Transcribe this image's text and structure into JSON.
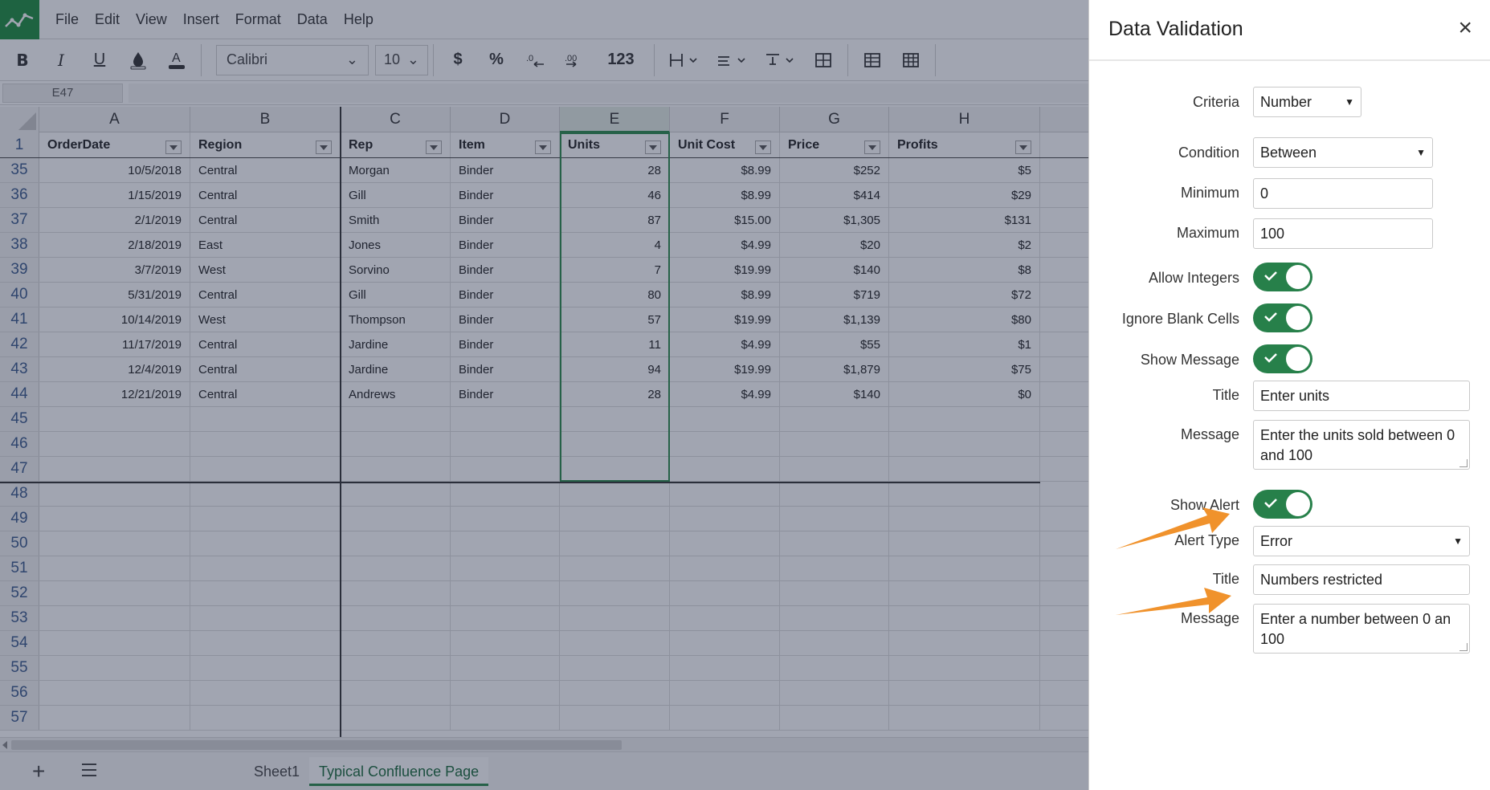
{
  "menu": [
    "File",
    "Edit",
    "View",
    "Insert",
    "Format",
    "Data",
    "Help"
  ],
  "toolbar": {
    "font": "Calibri",
    "size": "10",
    "currency": "$",
    "percent": "%",
    "number_format": "123"
  },
  "namebox": "E47",
  "columns": [
    "A",
    "B",
    "C",
    "D",
    "E",
    "F",
    "G",
    "H"
  ],
  "header_row": {
    "num": "1",
    "cells": [
      "OrderDate",
      "Region",
      "Rep",
      "Item",
      "Units",
      "Unit Cost",
      "Price",
      "Profits"
    ]
  },
  "rows": [
    {
      "num": "35",
      "cells": [
        "10/5/2018",
        "Central",
        "Morgan",
        "Binder",
        "28",
        "$8.99",
        "$252",
        "$5"
      ]
    },
    {
      "num": "36",
      "cells": [
        "1/15/2019",
        "Central",
        "Gill",
        "Binder",
        "46",
        "$8.99",
        "$414",
        "$29"
      ]
    },
    {
      "num": "37",
      "cells": [
        "2/1/2019",
        "Central",
        "Smith",
        "Binder",
        "87",
        "$15.00",
        "$1,305",
        "$131"
      ]
    },
    {
      "num": "38",
      "cells": [
        "2/18/2019",
        "East",
        "Jones",
        "Binder",
        "4",
        "$4.99",
        "$20",
        "$2"
      ]
    },
    {
      "num": "39",
      "cells": [
        "3/7/2019",
        "West",
        "Sorvino",
        "Binder",
        "7",
        "$19.99",
        "$140",
        "$8"
      ]
    },
    {
      "num": "40",
      "cells": [
        "5/31/2019",
        "Central",
        "Gill",
        "Binder",
        "80",
        "$8.99",
        "$719",
        "$72"
      ]
    },
    {
      "num": "41",
      "cells": [
        "10/14/2019",
        "West",
        "Thompson",
        "Binder",
        "57",
        "$19.99",
        "$1,139",
        "$80"
      ]
    },
    {
      "num": "42",
      "cells": [
        "11/17/2019",
        "Central",
        "Jardine",
        "Binder",
        "11",
        "$4.99",
        "$55",
        "$1"
      ]
    },
    {
      "num": "43",
      "cells": [
        "12/4/2019",
        "Central",
        "Jardine",
        "Binder",
        "94",
        "$19.99",
        "$1,879",
        "$75"
      ]
    },
    {
      "num": "44",
      "cells": [
        "12/21/2019",
        "Central",
        "Andrews",
        "Binder",
        "28",
        "$4.99",
        "$140",
        "$0"
      ]
    }
  ],
  "empty_rows": [
    "45",
    "46",
    "47",
    "48",
    "49",
    "50",
    "51",
    "52",
    "53",
    "54",
    "55",
    "56",
    "57"
  ],
  "sheets": [
    "Sheet1",
    "Typical Confluence Page"
  ],
  "panel": {
    "title": "Data Validation",
    "close": "×",
    "criteria_label": "Criteria",
    "criteria_value": "Number",
    "condition_label": "Condition",
    "condition_value": "Between",
    "minimum_label": "Minimum",
    "minimum_value": "0",
    "maximum_label": "Maximum",
    "maximum_value": "100",
    "allow_integers_label": "Allow Integers",
    "ignore_blank_label": "Ignore Blank Cells",
    "show_message_label": "Show Message",
    "msg_title_label": "Title",
    "msg_title_value": "Enter units",
    "msg_message_label": "Message",
    "msg_message_value": "Enter the units sold between 0 and 100",
    "show_alert_label": "Show Alert",
    "alert_type_label": "Alert Type",
    "alert_type_value": "Error",
    "alert_title_label": "Title",
    "alert_title_value": "Numbers restricted",
    "alert_message_label": "Message",
    "alert_message_value": "Enter a number between 0 an 100"
  },
  "colors": {
    "accent": "#2c8a4a",
    "toggle_on": "#27804a",
    "arrow": "#f0922c",
    "overlay": "rgba(30,40,70,0.42)"
  }
}
